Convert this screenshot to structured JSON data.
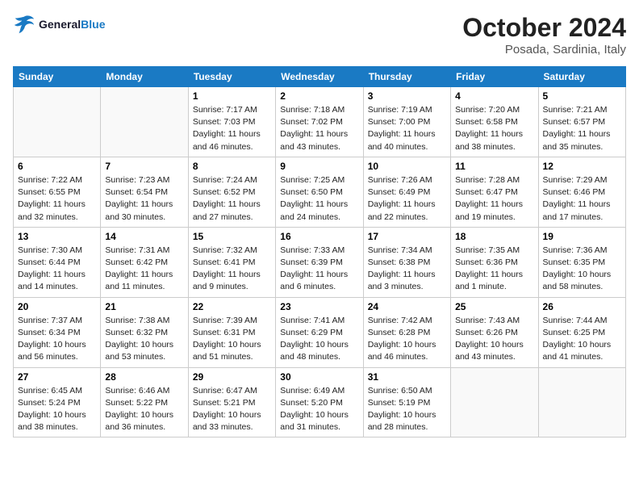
{
  "header": {
    "logo": {
      "line1": "General",
      "line2": "Blue"
    },
    "title": "October 2024",
    "subtitle": "Posada, Sardinia, Italy"
  },
  "days_of_week": [
    "Sunday",
    "Monday",
    "Tuesday",
    "Wednesday",
    "Thursday",
    "Friday",
    "Saturday"
  ],
  "weeks": [
    [
      {
        "day": "",
        "content": ""
      },
      {
        "day": "",
        "content": ""
      },
      {
        "day": "1",
        "content": "Sunrise: 7:17 AM\nSunset: 7:03 PM\nDaylight: 11 hours and 46 minutes."
      },
      {
        "day": "2",
        "content": "Sunrise: 7:18 AM\nSunset: 7:02 PM\nDaylight: 11 hours and 43 minutes."
      },
      {
        "day": "3",
        "content": "Sunrise: 7:19 AM\nSunset: 7:00 PM\nDaylight: 11 hours and 40 minutes."
      },
      {
        "day": "4",
        "content": "Sunrise: 7:20 AM\nSunset: 6:58 PM\nDaylight: 11 hours and 38 minutes."
      },
      {
        "day": "5",
        "content": "Sunrise: 7:21 AM\nSunset: 6:57 PM\nDaylight: 11 hours and 35 minutes."
      }
    ],
    [
      {
        "day": "6",
        "content": "Sunrise: 7:22 AM\nSunset: 6:55 PM\nDaylight: 11 hours and 32 minutes."
      },
      {
        "day": "7",
        "content": "Sunrise: 7:23 AM\nSunset: 6:54 PM\nDaylight: 11 hours and 30 minutes."
      },
      {
        "day": "8",
        "content": "Sunrise: 7:24 AM\nSunset: 6:52 PM\nDaylight: 11 hours and 27 minutes."
      },
      {
        "day": "9",
        "content": "Sunrise: 7:25 AM\nSunset: 6:50 PM\nDaylight: 11 hours and 24 minutes."
      },
      {
        "day": "10",
        "content": "Sunrise: 7:26 AM\nSunset: 6:49 PM\nDaylight: 11 hours and 22 minutes."
      },
      {
        "day": "11",
        "content": "Sunrise: 7:28 AM\nSunset: 6:47 PM\nDaylight: 11 hours and 19 minutes."
      },
      {
        "day": "12",
        "content": "Sunrise: 7:29 AM\nSunset: 6:46 PM\nDaylight: 11 hours and 17 minutes."
      }
    ],
    [
      {
        "day": "13",
        "content": "Sunrise: 7:30 AM\nSunset: 6:44 PM\nDaylight: 11 hours and 14 minutes."
      },
      {
        "day": "14",
        "content": "Sunrise: 7:31 AM\nSunset: 6:42 PM\nDaylight: 11 hours and 11 minutes."
      },
      {
        "day": "15",
        "content": "Sunrise: 7:32 AM\nSunset: 6:41 PM\nDaylight: 11 hours and 9 minutes."
      },
      {
        "day": "16",
        "content": "Sunrise: 7:33 AM\nSunset: 6:39 PM\nDaylight: 11 hours and 6 minutes."
      },
      {
        "day": "17",
        "content": "Sunrise: 7:34 AM\nSunset: 6:38 PM\nDaylight: 11 hours and 3 minutes."
      },
      {
        "day": "18",
        "content": "Sunrise: 7:35 AM\nSunset: 6:36 PM\nDaylight: 11 hours and 1 minute."
      },
      {
        "day": "19",
        "content": "Sunrise: 7:36 AM\nSunset: 6:35 PM\nDaylight: 10 hours and 58 minutes."
      }
    ],
    [
      {
        "day": "20",
        "content": "Sunrise: 7:37 AM\nSunset: 6:34 PM\nDaylight: 10 hours and 56 minutes."
      },
      {
        "day": "21",
        "content": "Sunrise: 7:38 AM\nSunset: 6:32 PM\nDaylight: 10 hours and 53 minutes."
      },
      {
        "day": "22",
        "content": "Sunrise: 7:39 AM\nSunset: 6:31 PM\nDaylight: 10 hours and 51 minutes."
      },
      {
        "day": "23",
        "content": "Sunrise: 7:41 AM\nSunset: 6:29 PM\nDaylight: 10 hours and 48 minutes."
      },
      {
        "day": "24",
        "content": "Sunrise: 7:42 AM\nSunset: 6:28 PM\nDaylight: 10 hours and 46 minutes."
      },
      {
        "day": "25",
        "content": "Sunrise: 7:43 AM\nSunset: 6:26 PM\nDaylight: 10 hours and 43 minutes."
      },
      {
        "day": "26",
        "content": "Sunrise: 7:44 AM\nSunset: 6:25 PM\nDaylight: 10 hours and 41 minutes."
      }
    ],
    [
      {
        "day": "27",
        "content": "Sunrise: 6:45 AM\nSunset: 5:24 PM\nDaylight: 10 hours and 38 minutes."
      },
      {
        "day": "28",
        "content": "Sunrise: 6:46 AM\nSunset: 5:22 PM\nDaylight: 10 hours and 36 minutes."
      },
      {
        "day": "29",
        "content": "Sunrise: 6:47 AM\nSunset: 5:21 PM\nDaylight: 10 hours and 33 minutes."
      },
      {
        "day": "30",
        "content": "Sunrise: 6:49 AM\nSunset: 5:20 PM\nDaylight: 10 hours and 31 minutes."
      },
      {
        "day": "31",
        "content": "Sunrise: 6:50 AM\nSunset: 5:19 PM\nDaylight: 10 hours and 28 minutes."
      },
      {
        "day": "",
        "content": ""
      },
      {
        "day": "",
        "content": ""
      }
    ]
  ]
}
